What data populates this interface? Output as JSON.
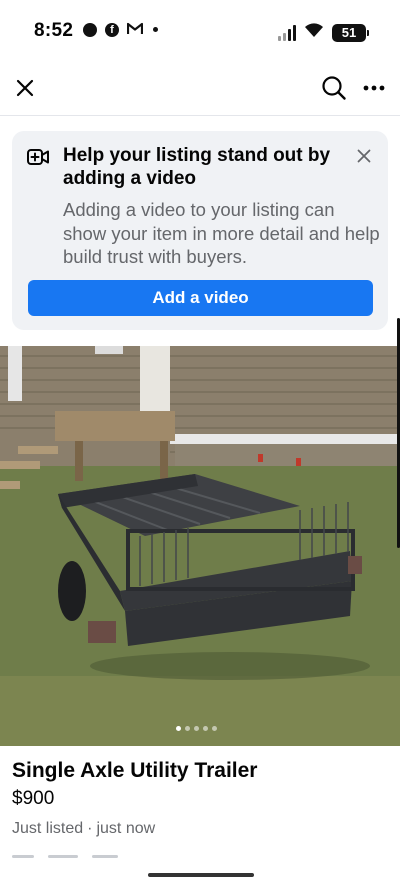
{
  "status_bar": {
    "time": "8:52",
    "battery": "51",
    "left_icons": [
      "notification-dot-icon",
      "facebook-icon",
      "gmail-icon",
      "more-notifications-dot"
    ],
    "right_icons": [
      "signal-icon",
      "wifi-icon",
      "battery-icon"
    ]
  },
  "nav": {
    "close_icon": "close-icon",
    "search_icon": "search-icon",
    "more_icon": "more-options-icon"
  },
  "promo": {
    "title": "Help your listing stand out by adding a video",
    "body": "Adding a video to your listing can show your item in more detail and help build trust with buyers.",
    "button_label": "Add a video",
    "icon": "video-add-icon",
    "dismiss_icon": "close-icon"
  },
  "photo": {
    "total": 5,
    "current": 1
  },
  "listing": {
    "title": "Single Axle Utility Trailer",
    "price": "$900",
    "listed": "Just listed",
    "separator": "·",
    "time": "just now"
  },
  "colors": {
    "accent": "#1877f2",
    "card_bg": "#f0f2f5",
    "secondary_text": "#65676b",
    "primary_text": "#050505"
  }
}
